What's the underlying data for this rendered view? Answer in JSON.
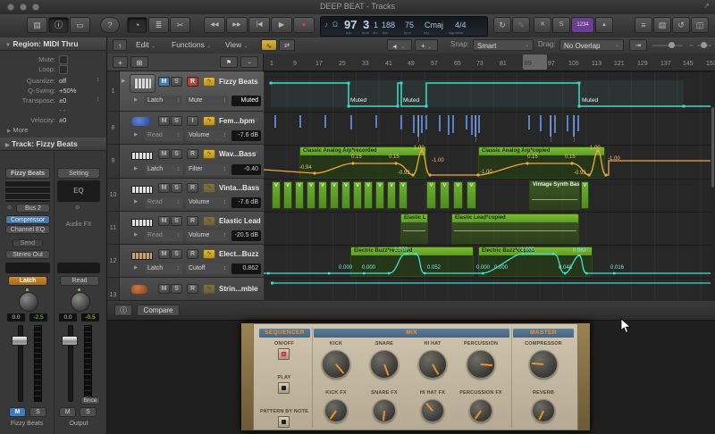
{
  "titlebar": {
    "title": "DEEP BEAT - Tracks"
  },
  "icons": {
    "library": "▤",
    "inspector": "ⓘ",
    "quick_help": "▭",
    "help": "?",
    "smart_controls": "◔",
    "mixer": "≣",
    "editors": "✂",
    "rewind": "◀◀",
    "forward": "▶▶",
    "stop": "|◀",
    "play": "▶",
    "record": "●",
    "note": "♪",
    "bell": "Ω",
    "cycle": "↻",
    "autopunch": "✎",
    "replace": "✕",
    "solo": "S",
    "list": "≡",
    "note_pads": "▤",
    "loops": "↺",
    "media": "◫",
    "fullscreen": "↗",
    "plus": "+",
    "folder_plus": "⊞",
    "chev": "⌄",
    "tri_right": "▶",
    "tri_down": "▼",
    "updown": "↕",
    "circle": "○",
    "arrow_up": "↑",
    "pointer_tool": "➤",
    "cross_tool": "+",
    "hzoom": "↔",
    "link": "⊖",
    "auto_node": "∿",
    "info": "ⓘ",
    "metronome": "▲",
    "catch": "⇥"
  },
  "controlbar": {
    "count_in": "1234",
    "lcd": {
      "bar": "97",
      "beat": "3",
      "div": "1",
      "tick": "188",
      "tempo": "75",
      "key": "Cmaj",
      "signature": "4/4",
      "label_bar": "bar",
      "label_beat": "beat",
      "label_div": "div",
      "label_tick": "tick",
      "label_tempo": "bpm",
      "label_key": "key",
      "label_sig": "signature"
    }
  },
  "trackmenu": {
    "edit": "Edit",
    "functions": "Functions",
    "view": "View",
    "snap_label": "Snap:",
    "snap_value": "Smart",
    "drag_label": "Drag:",
    "drag_value": "No Overlap"
  },
  "inspector": {
    "region_header": "Region: MIDI Thru",
    "mute_label": "Mute:",
    "loop_label": "Loop:",
    "quantize_label": "Quantize:",
    "quantize_value": "off",
    "qswing_label": "Q-Swing:",
    "qswing_value": "+50%",
    "transpose_label": "Transpose:",
    "transpose_value": "±0",
    "dash_value": "- -",
    "velocity_label": "Velocity:",
    "velocity_value": "±0",
    "more": "More",
    "track_header": "Track: Fizzy Beats",
    "left": {
      "name": "Fizzy Beats",
      "bus": "Bus 2",
      "insert1": "Compressor",
      "insert2": "Channel EQ",
      "send": "Send",
      "output": "Stereo Out",
      "mode": "Latch",
      "pan": "0.0",
      "level": "-2.5",
      "mute": "M",
      "solo": "S",
      "label": "Fizzy Beats"
    },
    "right": {
      "setting": "Setting",
      "eq": "EQ",
      "fx": "Audio FX",
      "mode": "Read",
      "pan": "0.0",
      "level": "-0.5",
      "bounce": "Bnce",
      "mute": "M",
      "solo": "S",
      "label": "Output"
    }
  },
  "ruler": {
    "n": [
      "1",
      "9",
      "17",
      "25",
      "33",
      "41",
      "49",
      "57",
      "65",
      "73",
      "81",
      "89",
      "97",
      "105",
      "113",
      "121",
      "129",
      "137",
      "145",
      "153"
    ]
  },
  "tracks": [
    {
      "num": "1",
      "name": "Fizzy Beats",
      "m": "M",
      "s": "S",
      "r": "R",
      "mode": "Latch",
      "param": "Mute",
      "value": "Muted"
    },
    {
      "num": "8",
      "name": "Fem...bpm",
      "m": "M",
      "s": "S",
      "i": "I",
      "mode": "Read",
      "param": "Volume",
      "value": "-7.6 dB"
    },
    {
      "num": "9",
      "name": "Wav...Bass",
      "m": "M",
      "s": "S",
      "r": "R",
      "mode": "Latch",
      "param": "Filter",
      "value": "-0.40"
    },
    {
      "num": "10",
      "name": "Vinta...Bass",
      "m": "M",
      "s": "S",
      "r": "R",
      "mode": "Read",
      "param": "Volume",
      "value": "-7.6 dB"
    },
    {
      "num": "11",
      "name": "Elastic Lead",
      "m": "M",
      "s": "S",
      "r": "R",
      "mode": "Read",
      "param": "Volume",
      "value": "-20.5 dB"
    },
    {
      "num": "12",
      "name": "Elect...Buzz",
      "m": "M",
      "s": "S",
      "r": "R",
      "mode": "Latch",
      "param": "Cutoff",
      "value": "0.862"
    },
    {
      "num": "13",
      "name": "Strin...mble",
      "m": "M",
      "s": "S",
      "r": "R"
    }
  ],
  "regions": {
    "muted": "Muted",
    "arp_recorded": "Classic Analog Arp*recorded",
    "arp_copied": "Classic Analog Arp*copied",
    "v": "V",
    "vintage": "Vintage Synth Bas",
    "elastic1": "Elastic L",
    "elastic2": "Elastic Lead*copied",
    "buzz_recorded": "Electric Buzz*recorded",
    "buzz_copied": "Electric Buzz*copied"
  },
  "auto9": [
    "-0.94",
    "0.15",
    "0.15",
    "-0.93",
    "1.00",
    "-1.00",
    "-1.00",
    "0.15",
    "0.15",
    "-0.93",
    "1.00",
    "-1.00"
  ],
  "auto12": [
    "0.000",
    "0.000",
    "1.000",
    "0.052",
    "0.000",
    "0.000",
    "1.000",
    "0.048",
    "0.962",
    "0.016"
  ],
  "plugin": {
    "compare": "Compare",
    "seq_title": "SEQUENCER",
    "mix_title": "MIX",
    "master_title": "MASTER",
    "onoff": "ON/OFF",
    "play": "PLAY",
    "pattern": "PATTERN BY NOTE",
    "kick": "KICK",
    "snare": "SNARE",
    "hihat": "HI HAT",
    "perc": "PERCUSSION",
    "kickfx": "KICK FX",
    "snarefx": "SNARE FX",
    "hihatfx": "HI HAT FX",
    "percfx": "PERCUSSION FX",
    "comp": "COMPRESSOR",
    "reverb": "REVERB"
  },
  "colors": {
    "region_green": "#61a32f",
    "automation_cyan": "#40e0d0",
    "automation_orange": "#f0a742",
    "record_red": "#c04030",
    "mute_blue": "#3e7cc0",
    "latch_orange": "#b56a20",
    "count_in_purple": "#6b3f8f",
    "lcd_text": "#a9c2e0"
  }
}
